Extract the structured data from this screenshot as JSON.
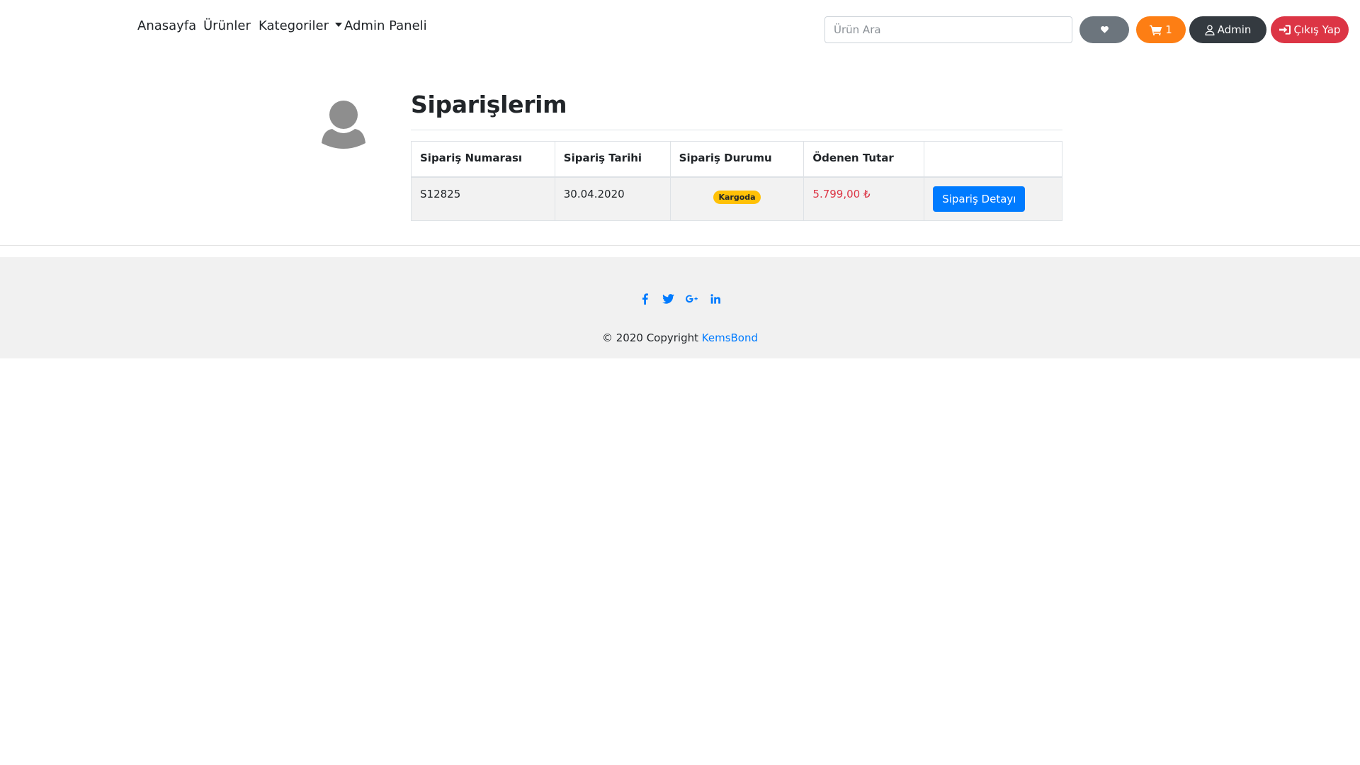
{
  "navbar": {
    "links": [
      {
        "label": "Anasayfa"
      },
      {
        "label": "Ürünler"
      },
      {
        "label": "Kategoriler"
      },
      {
        "label": "Admin Paneli"
      }
    ],
    "search": {
      "placeholder": "Ürün Ara",
      "value": ""
    },
    "favorites_icon": "heart-icon",
    "cart": {
      "count": "1",
      "icon": "cart-icon",
      "color": "#fd7e14"
    },
    "user": {
      "label": "Admin",
      "icon": "user-icon",
      "color": "#343a40"
    },
    "logout": {
      "label": "Çıkış Yap",
      "icon": "sign-in-icon",
      "color": "#dc3545"
    }
  },
  "main": {
    "avatar_icon": "user-avatar-icon",
    "title": "Siparişlerim",
    "table": {
      "columns": [
        "Sipariş Numarası",
        "Sipariş Tarihi",
        "Sipariş Durumu",
        "Ödenen Tutar",
        ""
      ],
      "rows": [
        {
          "order_no": "S12825",
          "date": "30.04.2020",
          "status": "Kargoda",
          "amount": "5.799,00 ₺",
          "action": "Sipariş Detayı"
        }
      ]
    }
  },
  "footer": {
    "socials": [
      "facebook-icon",
      "twitter-icon",
      "google-plus-icon",
      "linkedin-icon"
    ],
    "copyright_prefix": "© 2020 Copyright ",
    "brand": "KemsBond",
    "brand_color": "#007bff"
  },
  "colors": {
    "primary": "#007bff",
    "warning": "#ffc107",
    "danger": "#dc3545",
    "orange": "#fd7e14",
    "dark": "#343a40",
    "secondary": "#6c757d"
  }
}
